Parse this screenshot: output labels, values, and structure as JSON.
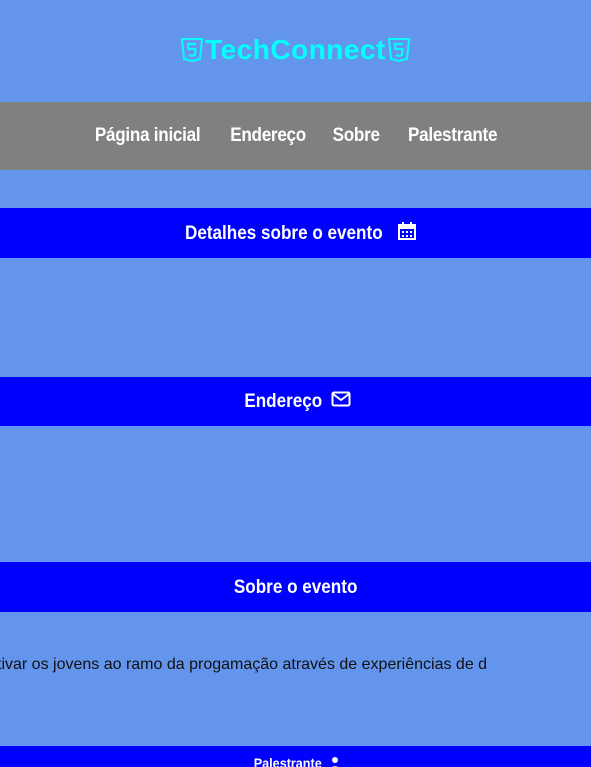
{
  "header": {
    "logo_text": "TechConnect",
    "logo_icon_left": "html5-icon",
    "logo_icon_right": "html5-icon",
    "logo_color": "#00FFFF"
  },
  "nav": {
    "items": [
      {
        "label": "Página inicial"
      },
      {
        "label": "Endereço"
      },
      {
        "label": "Sobre"
      },
      {
        "label": "Palestrante"
      }
    ],
    "background": "#808080"
  },
  "sections": {
    "detalhes": {
      "title": "Detalhes sobre o evento",
      "icon": "calendar-icon"
    },
    "endereco": {
      "title": "Endereço",
      "icon": "envelope-icon"
    },
    "sobre": {
      "title": "Sobre o evento",
      "text": "tivar os jovens ao ramo da progamação através de experiências de d"
    },
    "palestrante": {
      "title": "Palestrante",
      "icon": "user-icon"
    }
  },
  "colors": {
    "page_background": "#6495ED",
    "section_header": "#0000FF",
    "header_text": "#FFFFFF"
  }
}
